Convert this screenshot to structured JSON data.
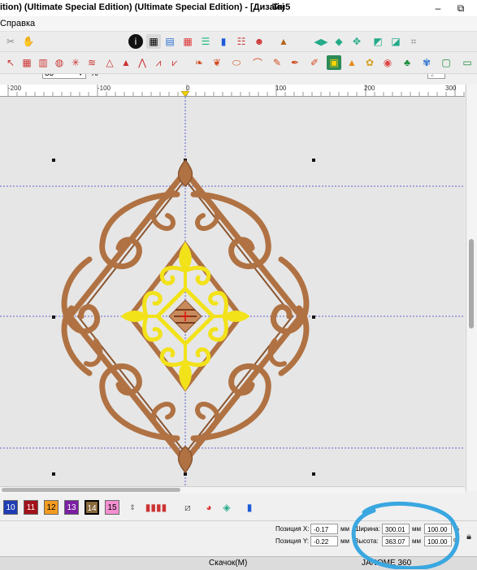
{
  "window": {
    "title": "ition) (Ultimate Special Edition) (Ultimate Special Edition) - [Дизайн5",
    "title_suffix": "Taj",
    "controls": [
      "–",
      "⧉"
    ]
  },
  "menu": {
    "help_label": "Справка"
  },
  "toolbar": {
    "zoom_value": "33",
    "zoom_unit": "%",
    "stitch_field_value": "2"
  },
  "ruler": {
    "labels": [
      "-200",
      "-100",
      "0",
      "100",
      "200",
      "300"
    ]
  },
  "palette": {
    "swatches": [
      {
        "label": "10",
        "color": "#1f3db5"
      },
      {
        "label": "11",
        "color": "#a3121a"
      },
      {
        "label": "12",
        "color": "#f39b1e"
      },
      {
        "label": "13",
        "color": "#7b1fa2"
      },
      {
        "label": "14",
        "color": "#8a6a3b"
      },
      {
        "label": "15",
        "color": "#f48fd1"
      }
    ]
  },
  "properties": {
    "pos_x_label": "Позиция X:",
    "pos_x_value": "-0.17",
    "pos_y_label": "Позиция Y:",
    "pos_y_value": "-0.22",
    "unit": "мм",
    "width_label": "Ширина:",
    "width_value": "300.01",
    "height_label": "Высота:",
    "height_value": "363.07",
    "width_pct": "100.00",
    "height_pct": "100.00",
    "pct_unit": "%"
  },
  "status": {
    "left_text": "Скачок(M)",
    "right_text": "JANOME 360"
  },
  "colors": {
    "embroidery_brown": "#b07243",
    "embroidery_yellow": "#f2e21a",
    "annotation_circle": "#3aa7e0",
    "guide_line": "#3a3acc"
  }
}
